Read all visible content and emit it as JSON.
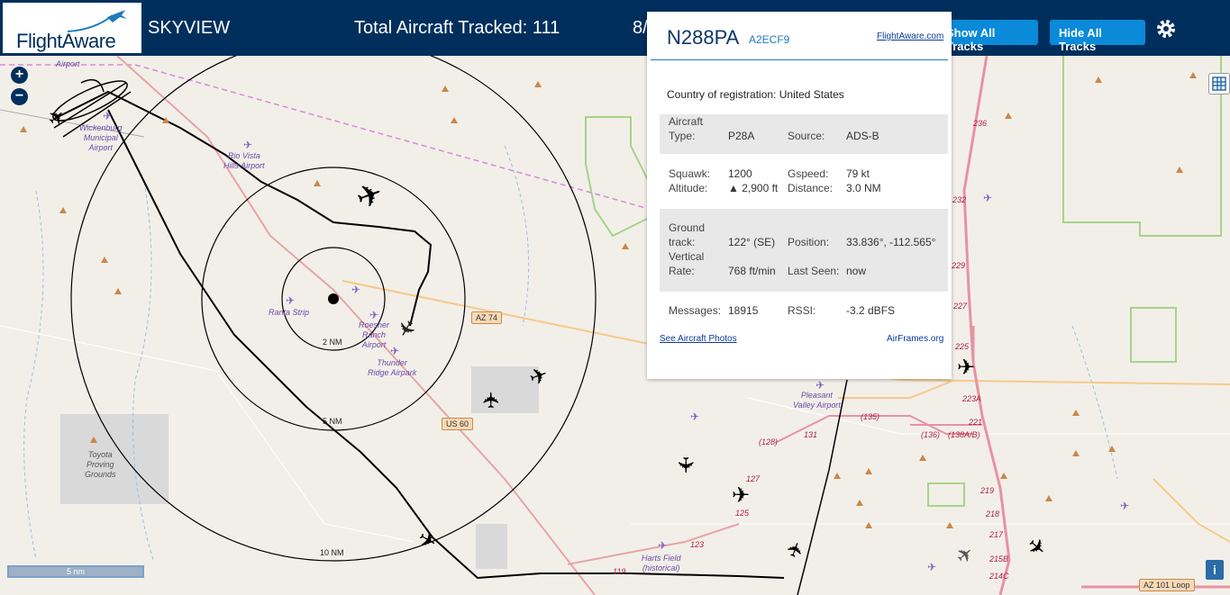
{
  "header": {
    "logo_text": "FlightAware",
    "app_name": "SKYVIEW",
    "total_tracked": "Total Aircraft Tracked: 111",
    "date_partial": "8/",
    "show_tracks_label": "Show All Tracks",
    "hide_tracks_label": "Hide All Tracks",
    "settings_icon": "gear-icon"
  },
  "map": {
    "zoom_in": "+",
    "zoom_out": "−",
    "scale_label": "5 nm",
    "info_label": "i",
    "range_rings": [
      "2 NM",
      "5 NM",
      "10 NM"
    ],
    "places": {
      "airport_top": "Airport",
      "wickenburg": "Wickenburg\nMunicipal\nAirport",
      "rio_vista": "Rio Vista\nHills Airport",
      "ranta": "Ranta Strip",
      "roesner": "Roesner\nRanch\nAirport",
      "thunder_ridge": "Thunder\nRidge Airpark",
      "toyota": "Toyota\nProving\nGrounds",
      "pleasant_valley": "Pleasant\nValley Airport",
      "harts_field": "Harts Field\n(historical)"
    },
    "shields": {
      "az74": "AZ 74",
      "us60": "US 60",
      "az101": "AZ 101 Loop"
    },
    "road_numbers": [
      "236",
      "232",
      "229",
      "227",
      "225",
      "223A",
      "221",
      "219",
      "218",
      "217",
      "215B",
      "214C",
      "131",
      "127",
      "125",
      "123",
      "119",
      "(128)",
      "(135)",
      "(136)",
      "(138A/B)"
    ]
  },
  "popup": {
    "registration": "N288PA",
    "icao": "A2ECF9",
    "fa_link": "FlightAware.com",
    "country_label": "Country of registration:",
    "country_value": "United States",
    "aircraft_type_label": "Aircraft\nType:",
    "aircraft_type_value": "P28A",
    "source_label": "Source:",
    "source_value": "ADS-B",
    "squawk_label": "Squawk:",
    "squawk_value": "1200",
    "gspeed_label": "Gspeed:",
    "gspeed_value": "79 kt",
    "altitude_label": "Altitude:",
    "altitude_value": "▲ 2,900 ft",
    "distance_label": "Distance:",
    "distance_value": "3.0 NM",
    "ground_track_label": "Ground\ntrack:",
    "ground_track_value": "122° (SE)",
    "position_label": "Position:",
    "position_value": "33.836°, -112.565°",
    "vertical_rate_label": "Vertical\nRate:",
    "vertical_rate_value": "768 ft/min",
    "last_seen_label": "Last Seen:",
    "last_seen_value": "now",
    "messages_label": "Messages:",
    "messages_value": "18915",
    "rssi_label": "RSSI:",
    "rssi_value": "-3.2 dBFS",
    "photos_link": "See Aircraft Photos",
    "airframes_link": "AirFrames.org"
  },
  "colors": {
    "header_bg": "#002f5d",
    "button_bg": "#0a8ad8",
    "map_bg": "#f2efe9",
    "highway": "#e892a2",
    "secondary_road": "#f7c98a",
    "track_line": "#000000"
  }
}
